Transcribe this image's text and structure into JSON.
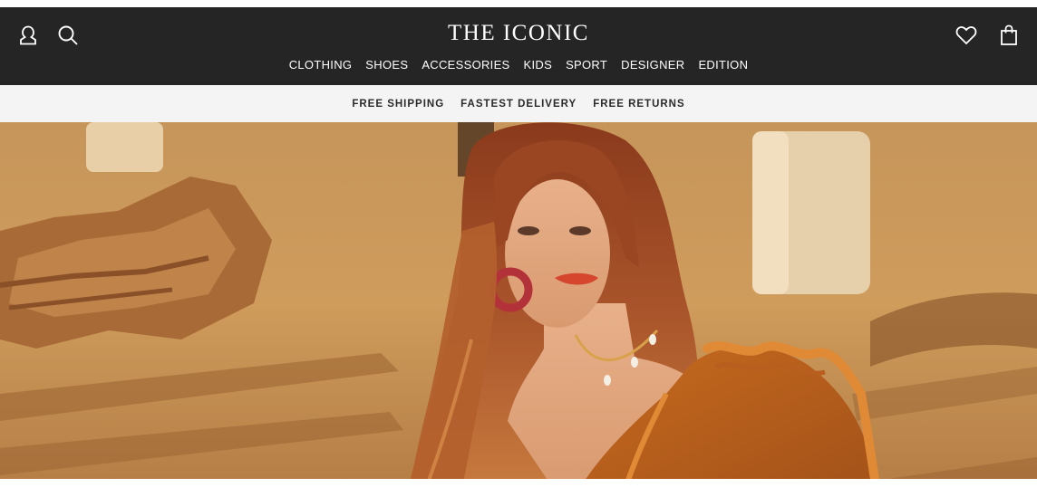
{
  "header": {
    "logo": "THE ICONIC",
    "nav": [
      {
        "label": "CLOTHING"
      },
      {
        "label": "SHOES"
      },
      {
        "label": "ACCESSORIES"
      },
      {
        "label": "KIDS"
      },
      {
        "label": "SPORT"
      },
      {
        "label": "DESIGNER"
      },
      {
        "label": "EDITION"
      }
    ],
    "icons": {
      "account": "user-icon",
      "search": "search-icon",
      "wishlist": "heart-icon",
      "bag": "shopping-bag-icon"
    }
  },
  "promo": {
    "items": [
      "FREE SHIPPING",
      "FASTEST DELIVERY",
      "FREE RETURNS"
    ]
  },
  "hero": {
    "image": "woman-in-orange-ruffled-dress-hero-image"
  },
  "colors": {
    "header_bg": "#252525",
    "promo_bg": "#f4f4f4",
    "text_light": "#ffffff",
    "text_dark": "#2a2a2a"
  }
}
